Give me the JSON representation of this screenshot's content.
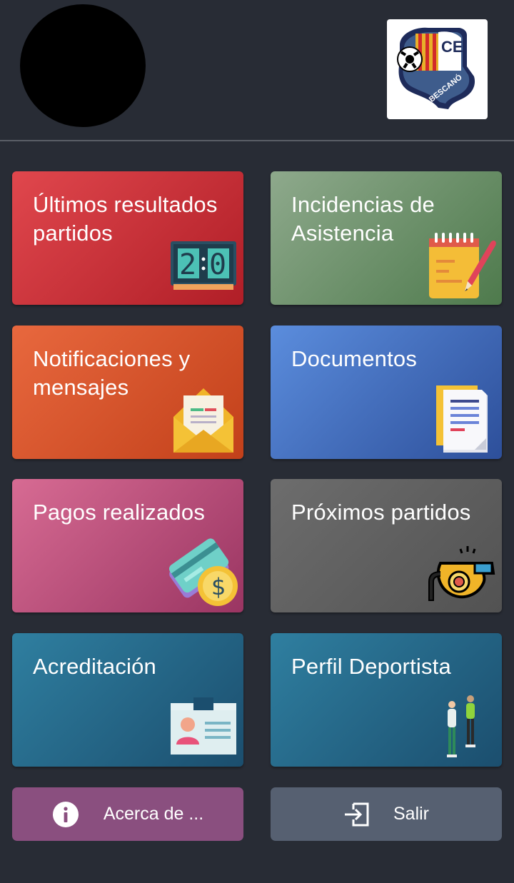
{
  "header": {
    "avatar_icon": "user-avatar",
    "logo": {
      "letters": "CE",
      "name": "BESCANÓ",
      "icon": "club-crest"
    }
  },
  "tiles": [
    {
      "label": "Últimos resultados partidos",
      "icon": "scoreboard-icon",
      "score": "2:0",
      "color": "#c8303a"
    },
    {
      "label": "Incidencias de Asistencia",
      "icon": "notepad-pen-icon",
      "color": "#6d8f6b"
    },
    {
      "label": "Notificaciones y mensajes",
      "icon": "envelope-icon",
      "color": "#d5532c"
    },
    {
      "label": "Documentos",
      "icon": "documents-icon",
      "color": "#4670c0"
    },
    {
      "label": "Pagos realizados",
      "icon": "card-coin-icon",
      "coin_symbol": "$",
      "color": "#b94d79"
    },
    {
      "label": "Próximos partidos",
      "icon": "whistle-icon",
      "color": "#5f5f5f"
    },
    {
      "label": "Acreditación",
      "icon": "id-badge-icon",
      "color": "#256785"
    },
    {
      "label": "Perfil Deportista",
      "icon": "athletes-icon",
      "color": "#256785"
    }
  ],
  "buttons": {
    "about": {
      "label": "Acerca de ...",
      "icon": "info-icon",
      "color": "#8a4f7f"
    },
    "exit": {
      "label": "Salir",
      "icon": "exit-icon",
      "color": "#566071"
    }
  },
  "colors": {
    "background": "#282c35",
    "divider": "#5a5e66"
  }
}
